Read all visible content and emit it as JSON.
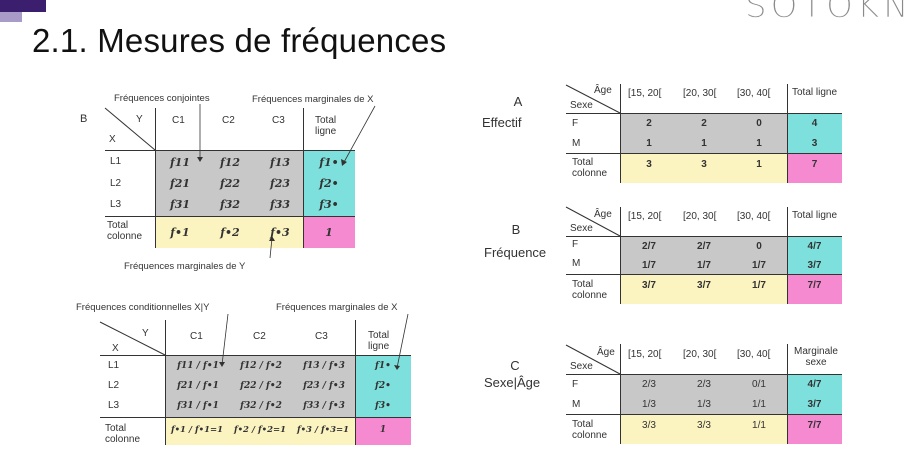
{
  "slide": {
    "title": "2.1. Mesures de fréquences",
    "logo": "SOTOKN"
  },
  "t1": {
    "corner": "B",
    "y": "Y",
    "x": "X",
    "cols": [
      "C1",
      "C2",
      "C3"
    ],
    "total_col": "Total ligne",
    "rows": [
      "L1",
      "L2",
      "L3"
    ],
    "total_row": "Total colonne",
    "cells": [
      [
        "f11",
        "f12",
        "f13"
      ],
      [
        "f21",
        "f22",
        "f23"
      ],
      [
        "f31",
        "f32",
        "f33"
      ]
    ],
    "row_tot": [
      "f1•",
      "f2•",
      "f3•"
    ],
    "col_tot": [
      "f•1",
      "f•2",
      "f•3"
    ],
    "grand": "1",
    "ann_joint": "Fréquences conjointes",
    "ann_margX": "Fréquences marginales de X",
    "ann_margY": "Fréquences marginales de Y"
  },
  "t2": {
    "y": "Y",
    "x": "X",
    "cols": [
      "C1",
      "C2",
      "C3"
    ],
    "total_col": "Total ligne",
    "rows": [
      "L1",
      "L2",
      "L3"
    ],
    "total_row": "Total colonne",
    "cells": [
      [
        "f11 / f•1",
        "f12 / f•2",
        "f13 / f•3"
      ],
      [
        "f21 / f•1",
        "f22 / f•2",
        "f23 / f•3"
      ],
      [
        "f31 / f•1",
        "f32 / f•2",
        "f33 / f•3"
      ]
    ],
    "row_tot": [
      "f1•",
      "f2•",
      "f3•"
    ],
    "col_tot": [
      "f•1 / f•1=1",
      "f•2 / f•2=1",
      "f•3 / f•3=1"
    ],
    "grand": "1",
    "ann_cond": "Fréquences conditionnelles X|Y",
    "ann_margX": "Fréquences marginales de X"
  },
  "tA": {
    "letter": "A",
    "name": "Effectif",
    "age": "Âge",
    "sexe": "Sexe",
    "cols": [
      "[15, 20[",
      "[20, 30[",
      "[30, 40["
    ],
    "total_col": "Total ligne",
    "rows": [
      "F",
      "M"
    ],
    "total_row": "Total colonne",
    "cells": [
      [
        "2",
        "2",
        "0"
      ],
      [
        "1",
        "1",
        "1"
      ]
    ],
    "row_tot": [
      "4",
      "3"
    ],
    "col_tot": [
      "3",
      "3",
      "1"
    ],
    "grand": "7"
  },
  "tB": {
    "letter": "B",
    "name": "Fréquence",
    "age": "Âge",
    "sexe": "Sexe",
    "cols": [
      "[15, 20[",
      "[20, 30[",
      "[30, 40["
    ],
    "total_col": "Total ligne",
    "rows": [
      "F",
      "M"
    ],
    "total_row": "Total colonne",
    "cells": [
      [
        "2/7",
        "2/7",
        "0"
      ],
      [
        "1/7",
        "1/7",
        "1/7"
      ]
    ],
    "row_tot": [
      "4/7",
      "3/7"
    ],
    "col_tot": [
      "3/7",
      "3/7",
      "1/7"
    ],
    "grand": "7/7"
  },
  "tC": {
    "letter": "C",
    "name": "Sexe|Âge",
    "age": "Âge",
    "sexe": "Sexe",
    "cols": [
      "[15, 20[",
      "[20, 30[",
      "[30, 40["
    ],
    "total_col": "Marginale sexe",
    "rows": [
      "F",
      "M"
    ],
    "total_row": "Total colonne",
    "cells": [
      [
        "2/3",
        "2/3",
        "0/1"
      ],
      [
        "1/3",
        "1/3",
        "1/1"
      ]
    ],
    "row_tot": [
      "4/7",
      "3/7"
    ],
    "col_tot": [
      "3/3",
      "3/3",
      "1/1"
    ],
    "grand": "7/7"
  },
  "colors": {
    "gray": "#c8c8c8",
    "cyan": "#7ee0dc",
    "yellow": "#fbf3c0",
    "pink": "#f58ad0"
  }
}
